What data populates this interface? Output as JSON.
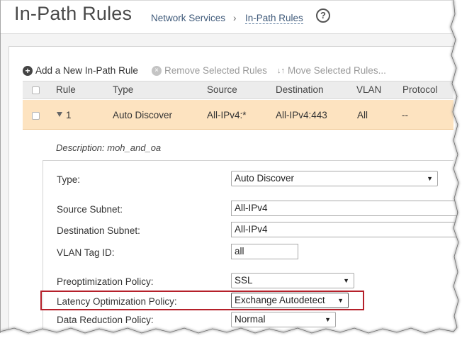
{
  "header": {
    "title": "In-Path Rules",
    "breadcrumb": [
      "Network Services",
      "›",
      "In-Path Rules"
    ],
    "help_glyph": "?"
  },
  "toolbar": {
    "add_label": "Add a New In-Path Rule",
    "add_glyph": "+",
    "remove_label": "Remove Selected Rules",
    "remove_glyph": "×",
    "move_label": "Move Selected Rules...",
    "move_glyph": "↓↑"
  },
  "table": {
    "columns": [
      "Rule",
      "Type",
      "Source",
      "Destination",
      "VLAN",
      "Protocol"
    ],
    "row": {
      "rule": "1",
      "type": "Auto Discover",
      "source": "All-IPv4:*",
      "destination": "All-IPv4:443",
      "vlan": "All",
      "protocol": "--"
    },
    "description": "Description: moh_and_oa"
  },
  "form": {
    "type_label": "Type:",
    "type_value": "Auto Discover",
    "source_subnet_label": "Source Subnet:",
    "source_subnet_value": "All-IPv4",
    "dest_subnet_label": "Destination Subnet:",
    "dest_subnet_value": "All-IPv4",
    "vlan_label": "VLAN Tag ID:",
    "vlan_value": "all",
    "preopt_label": "Preoptimization Policy:",
    "preopt_value": "SSL",
    "latency_label": "Latency Optimization Policy:",
    "latency_value": "Exchange Autodetect",
    "datared_label": "Data Reduction Policy:",
    "datared_value": "Normal",
    "arrow_glyph": "▼"
  },
  "colors": {
    "selected_row": "#fde3c0",
    "highlight_border": "#b5202a",
    "breadcrumb": "#3f5a7a"
  }
}
